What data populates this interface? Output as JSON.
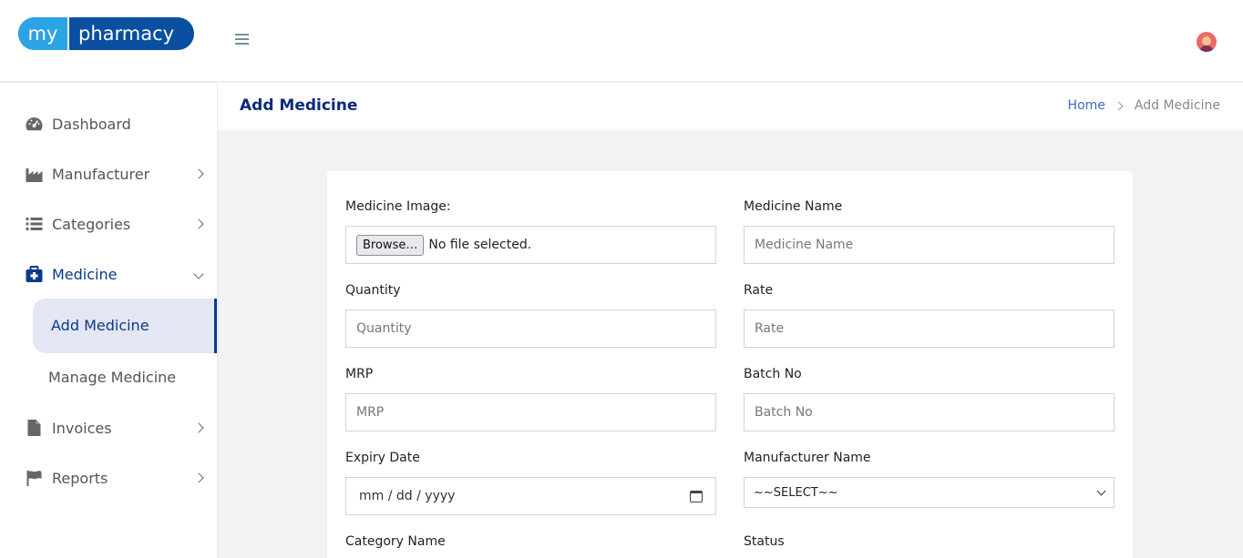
{
  "brand": {
    "part1": "my",
    "part2": "pharmacy"
  },
  "icons": {
    "menu": "hamburger-icon",
    "user": "avatar-icon"
  },
  "sidebar": {
    "items": [
      {
        "label": "Dashboard",
        "icon": "dashboard-icon"
      },
      {
        "label": "Manufacturer",
        "icon": "industry-icon"
      },
      {
        "label": "Categories",
        "icon": "list-icon"
      },
      {
        "label": "Medicine",
        "icon": "medkit-icon"
      },
      {
        "label": "Invoices",
        "icon": "file-icon"
      },
      {
        "label": "Reports",
        "icon": "flag-icon"
      }
    ],
    "medicine_sub": [
      {
        "label": "Add Medicine",
        "active": true
      },
      {
        "label": "Manage Medicine",
        "active": false
      }
    ]
  },
  "page": {
    "title": "Add Medicine",
    "breadcrumb": {
      "home": "Home",
      "current": "Add Medicine"
    }
  },
  "form": {
    "image": {
      "label": "Medicine Image:",
      "button": "Browse…",
      "status": "No file selected."
    },
    "name": {
      "label": "Medicine Name",
      "placeholder": "Medicine Name"
    },
    "quantity": {
      "label": "Quantity",
      "placeholder": "Quantity"
    },
    "rate": {
      "label": "Rate",
      "placeholder": "Rate"
    },
    "mrp": {
      "label": "MRP",
      "placeholder": "MRP"
    },
    "batch": {
      "label": "Batch No",
      "placeholder": "Batch No"
    },
    "expiry": {
      "label": "Expiry Date",
      "placeholder": "mm / dd / yyyy"
    },
    "manufacturer": {
      "label": "Manufacturer Name",
      "selected": "~~SELECT~~"
    },
    "category": {
      "label": "Category Name"
    },
    "status": {
      "label": "Status"
    }
  },
  "colors": {
    "brand_dark": "#0a4fa0",
    "brand_light": "#2ba3e6",
    "accent": "#0a3a8a",
    "active_bg": "#e3e7f4"
  }
}
